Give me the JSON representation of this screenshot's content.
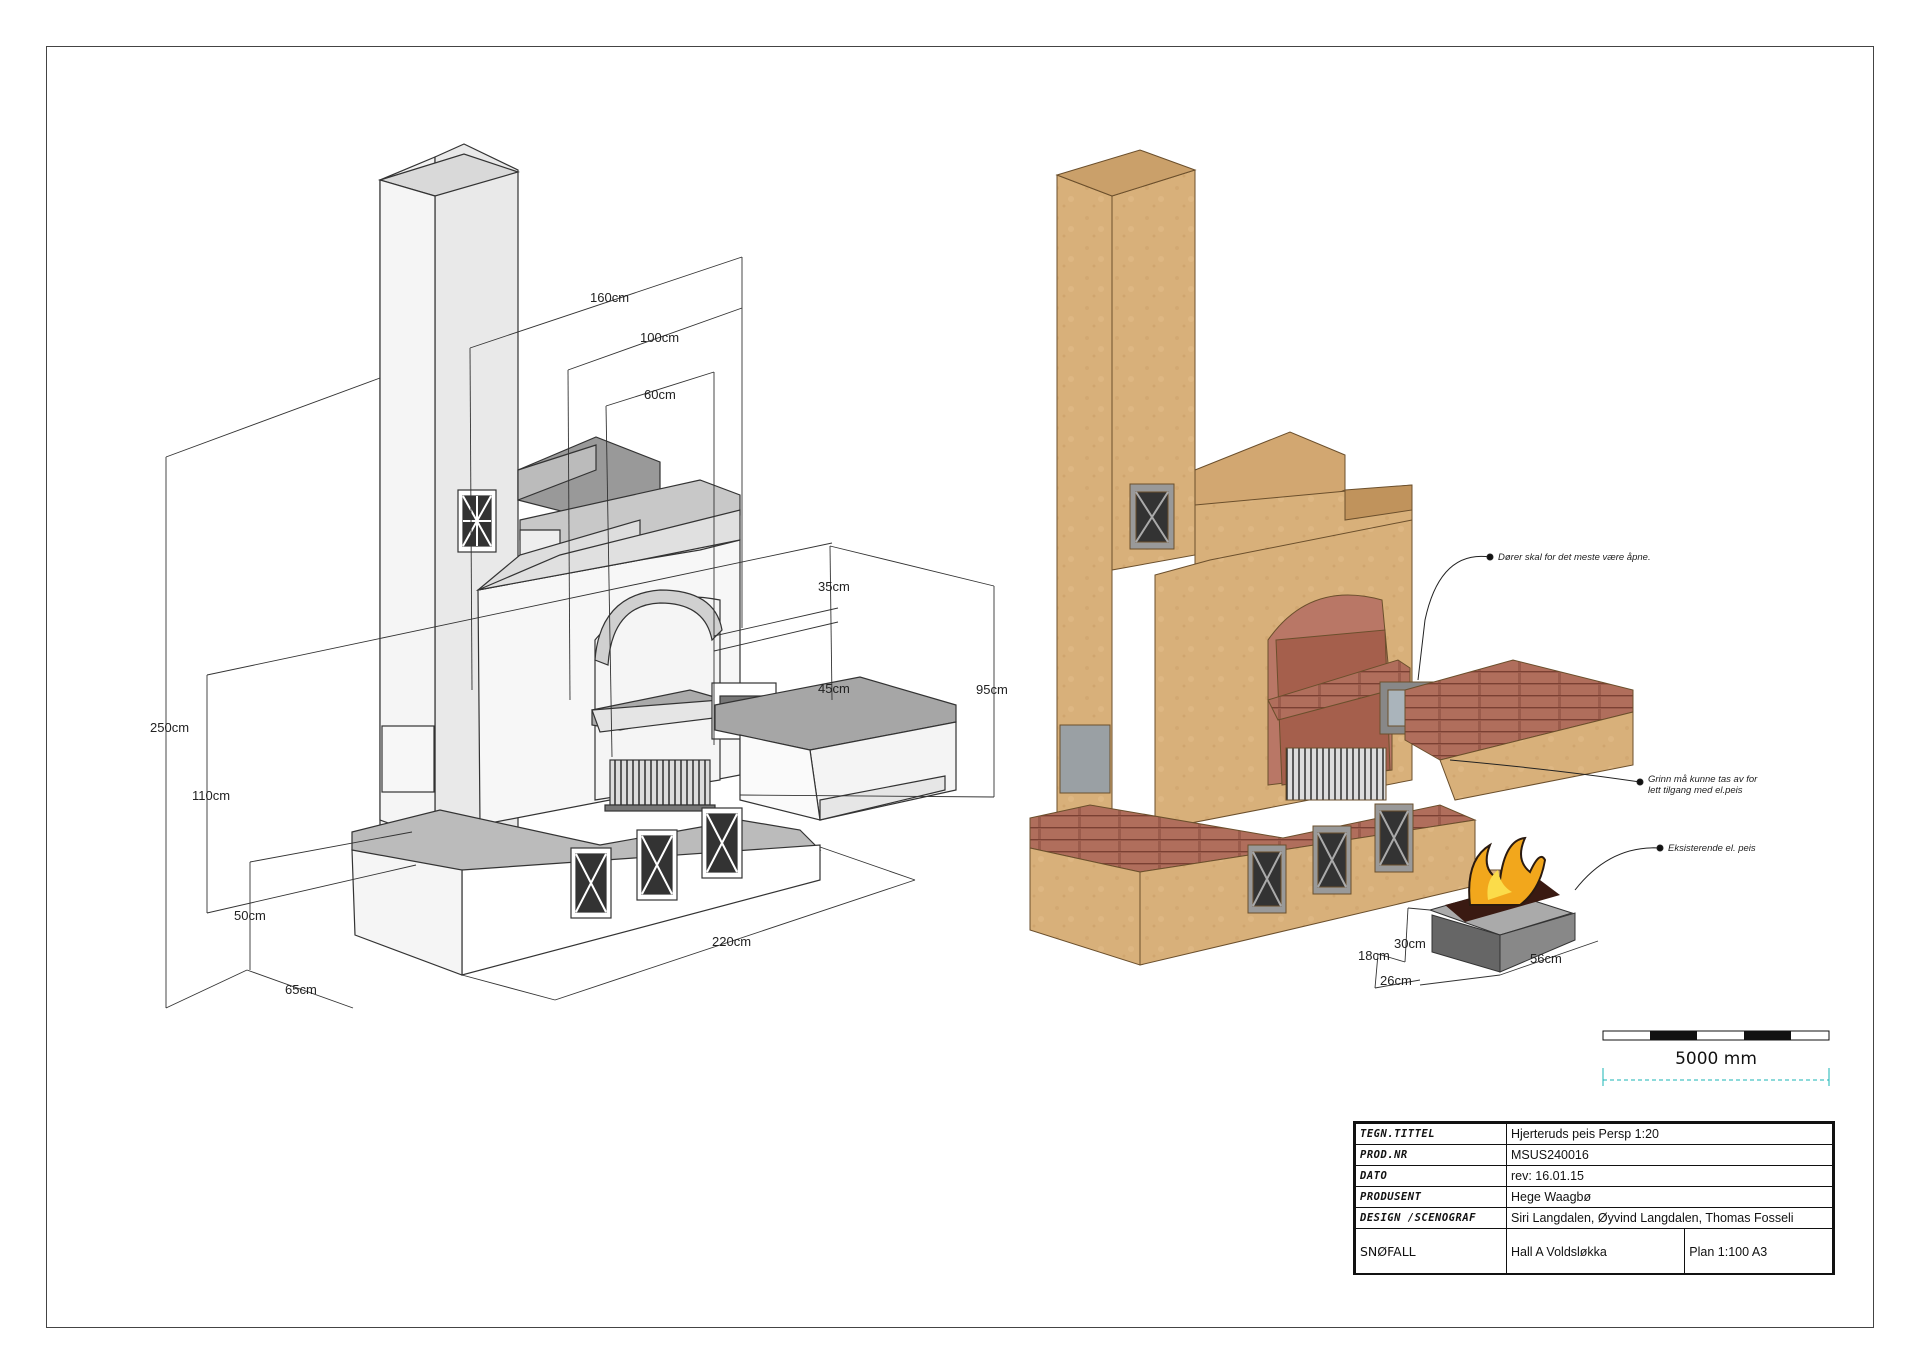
{
  "dimensions_left": {
    "d160": "160cm",
    "d100": "100cm",
    "d60": "60cm",
    "d35": "35cm",
    "d45": "45cm",
    "d95": "95cm",
    "d250": "250cm",
    "d110": "110cm",
    "d50": "50cm",
    "d65": "65cm",
    "d220": "220cm"
  },
  "dimensions_fireplace": {
    "d30": "30cm",
    "d18": "18cm",
    "d26": "26cm",
    "d56": "56cm"
  },
  "notes": {
    "doors": "Dører skal for det meste være åpne.",
    "grate_line1": "Grinn må kunne tas av for",
    "grate_line2": "lett tilgang med el.peis",
    "existing": "Eksisterende el. peis"
  },
  "scale_bar": {
    "label": "5000 mm"
  },
  "title_block": {
    "rows": [
      {
        "label": "TEGN.TITTEL",
        "value": "Hjerteruds peis Persp 1:20"
      },
      {
        "label": "PROD.NR",
        "value": "MSUS240016"
      },
      {
        "label": "DATO",
        "value": "rev: 16.01.15"
      },
      {
        "label": "PRODUSENT",
        "value": "Hege Waagbø"
      },
      {
        "label": "DESIGN /SCENOGRAF",
        "value": "Siri Langdalen, Øyvind Langdalen, Thomas Fosseli"
      }
    ],
    "company": "SNØFALL",
    "venue": "Hall A Voldsløkka",
    "plan": "Plan 1:100 A3"
  },
  "colors": {
    "sandstone": "#d9b27a",
    "sandstone_dark": "#c59a5e",
    "brick": "#9a5a4a",
    "line": "#333333"
  }
}
